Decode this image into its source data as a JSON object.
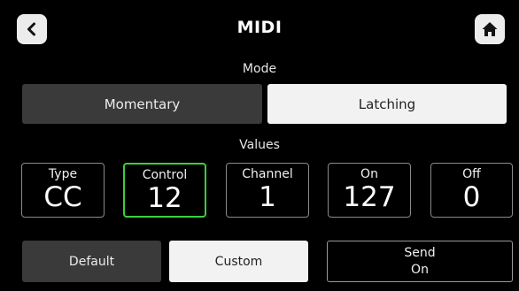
{
  "header": {
    "title": "MIDI",
    "back_icon": "chevron-left-icon",
    "home_icon": "home-icon"
  },
  "mode": {
    "label": "Mode",
    "options": [
      {
        "label": "Momentary",
        "selected": false
      },
      {
        "label": "Latching",
        "selected": true
      }
    ]
  },
  "values": {
    "label": "Values",
    "fields": [
      {
        "label": "Type",
        "value": "CC",
        "selected": false
      },
      {
        "label": "Control",
        "value": "12",
        "selected": true
      },
      {
        "label": "Channel",
        "value": "1",
        "selected": false
      },
      {
        "label": "On",
        "value": "127",
        "selected": false
      },
      {
        "label": "Off",
        "value": "0",
        "selected": false
      }
    ]
  },
  "footer": {
    "default_label": "Default",
    "custom_label": "Custom",
    "send_label_line1": "Send",
    "send_label_line2": "On"
  },
  "colors": {
    "background": "#000000",
    "selected_border": "#3ccf3c",
    "active_segment": "#f2f2f2",
    "inactive_segment": "#3a3a3a"
  }
}
